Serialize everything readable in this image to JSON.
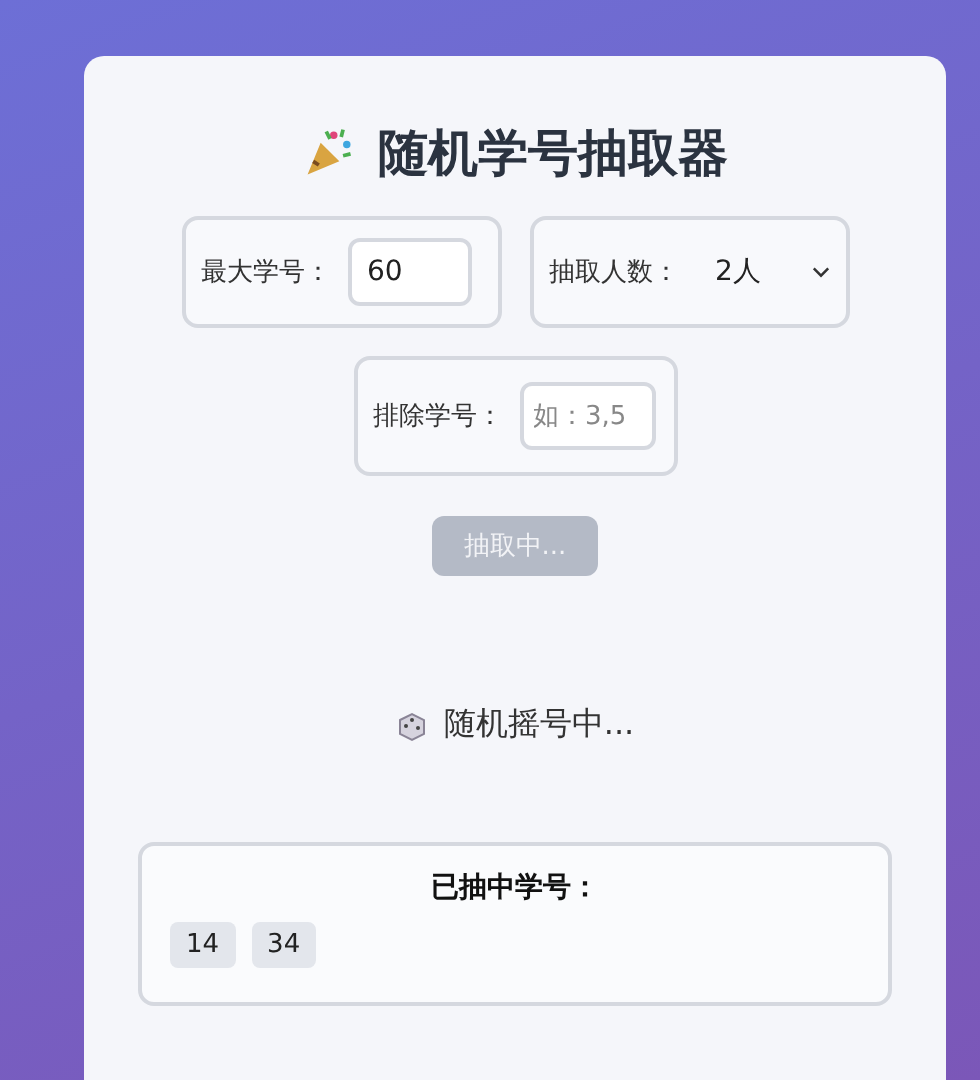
{
  "title": "随机学号抽取器",
  "fields": [
    {
      "kind": "input",
      "label": "最大学号：",
      "value": "60"
    },
    {
      "kind": "select",
      "label": "抽取人数：",
      "value": "2人"
    },
    {
      "kind": "input",
      "label": "排除学号：",
      "placeholder": "如：3,5"
    }
  ],
  "draw_button": {
    "label": "抽取中...",
    "disabled": true
  },
  "status": "随机摇号中...",
  "results": {
    "heading": "已抽中学号：",
    "numbers": [
      "14",
      "34"
    ]
  }
}
